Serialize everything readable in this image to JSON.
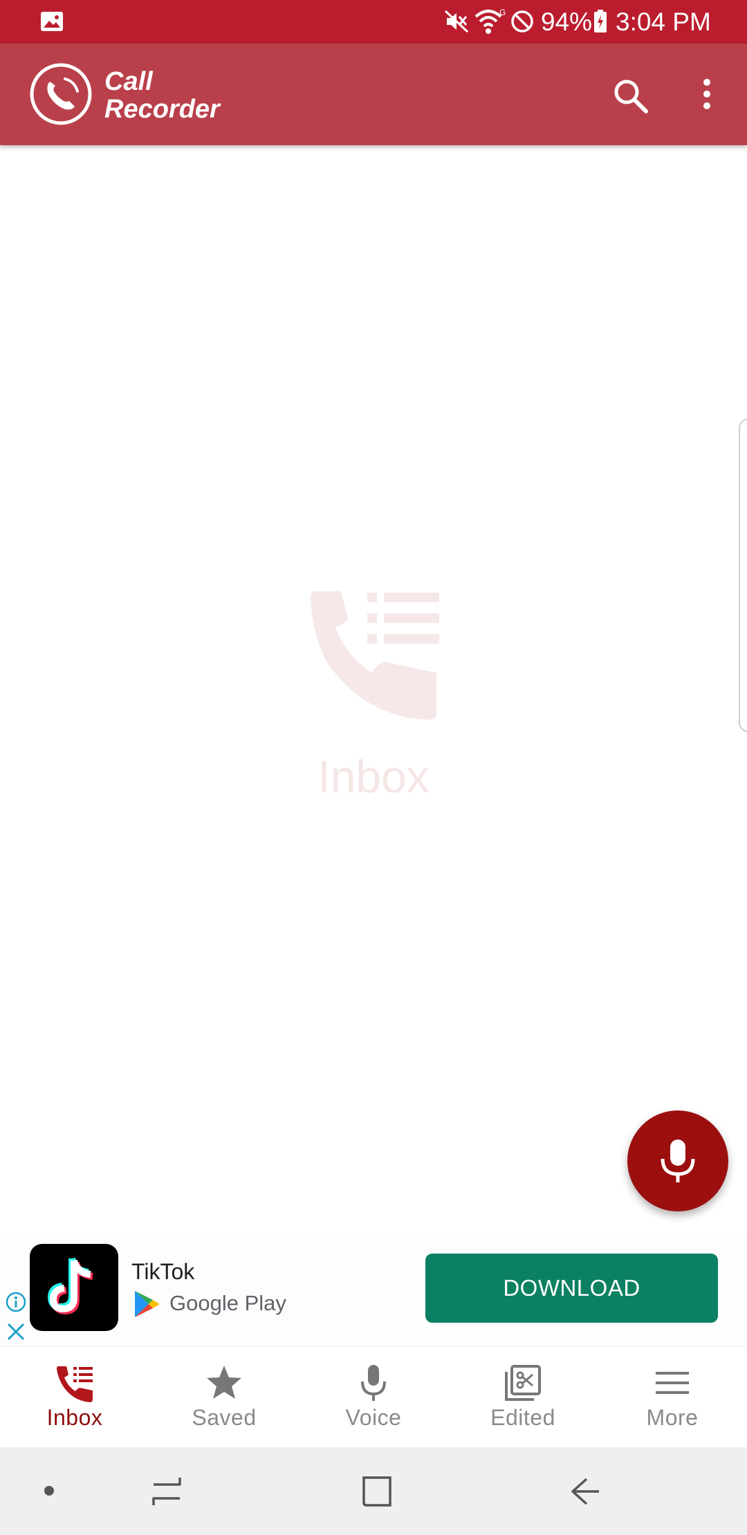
{
  "status_bar": {
    "battery": "94%",
    "time": "3:04 PM",
    "icons": [
      "gallery-icon",
      "mute-icon",
      "wifi-icon",
      "do-not-disturb-icon",
      "battery-charging-icon"
    ]
  },
  "app_bar": {
    "title": "Call Recorder",
    "icons": [
      "app-logo-icon",
      "search-icon",
      "more-vert-icon"
    ],
    "color": "#b9404b"
  },
  "empty_state": {
    "label": "Inbox",
    "icon": "call-list-icon"
  },
  "fab": {
    "icon": "microphone-icon",
    "color": "#9c0f0f"
  },
  "ad": {
    "title": "TikTok",
    "store": "Google Play",
    "cta": "DOWNLOAD",
    "cta_color": "#0b8062",
    "icons": [
      "ad-info-icon",
      "ad-close-icon",
      "tiktok-icon",
      "google-play-icon"
    ]
  },
  "bottom_nav": {
    "items": [
      {
        "label": "Inbox",
        "icon": "call-list-icon",
        "active": true
      },
      {
        "label": "Saved",
        "icon": "star-icon",
        "active": false
      },
      {
        "label": "Voice",
        "icon": "microphone-icon",
        "active": false
      },
      {
        "label": "Edited",
        "icon": "edit-clip-icon",
        "active": false
      },
      {
        "label": "More",
        "icon": "menu-icon",
        "active": false
      }
    ],
    "active_color": "#8e0e0e"
  },
  "system_nav": {
    "icons": [
      "dot-icon",
      "recents-icon",
      "home-icon",
      "back-icon"
    ]
  }
}
